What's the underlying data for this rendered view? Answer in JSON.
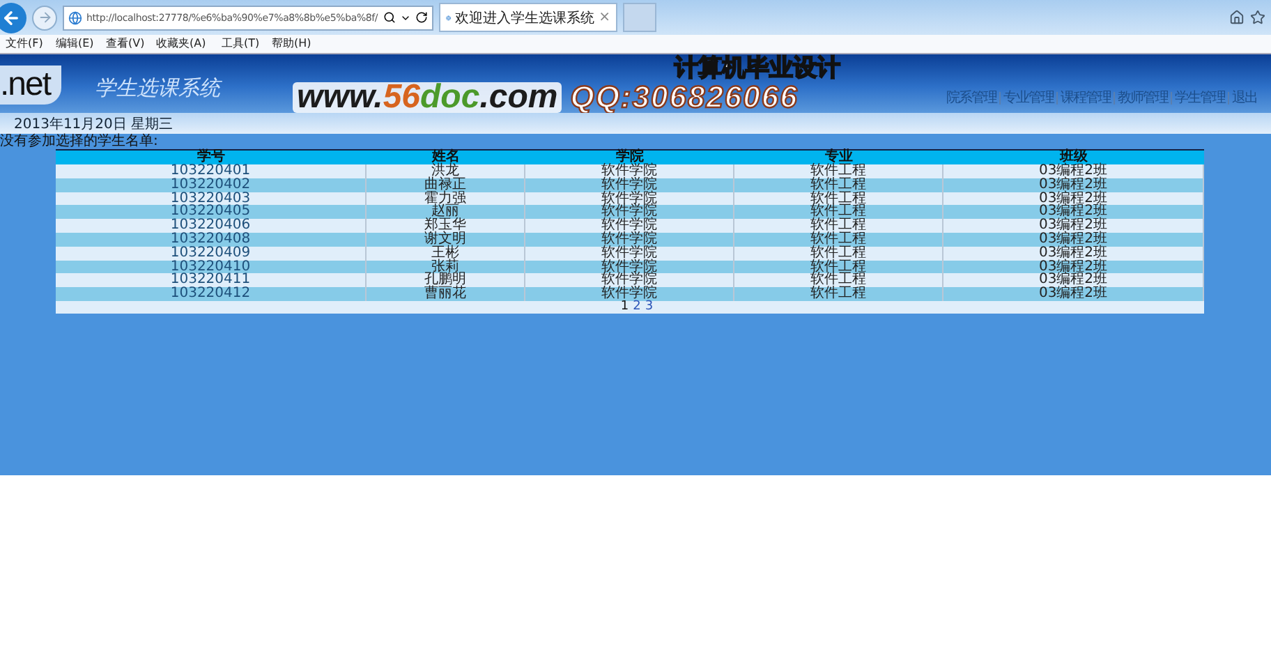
{
  "browser": {
    "address": "http://localhost:27778/%e6%ba%90%e7%a8%8b%e5%ba%8f/",
    "tab": {
      "title": "欢迎进入学生选课系统",
      "close": "×",
      "selected": true
    }
  },
  "menu_bar": [
    "文件(F)",
    "编辑(E)",
    "查看(V)",
    "收藏夹(A)",
    "工具(T)",
    "帮助(H)"
  ],
  "header": {
    "logo": ".net",
    "system_name": "学生选课系统",
    "slogan": "计算机毕业设计",
    "site": [
      {
        "text": "www.",
        "color": "#1c1c1c"
      },
      {
        "text": "56",
        "color": "#d7641e"
      },
      {
        "text": "doc",
        "color": "#4c9a2a"
      },
      {
        "text": ".com",
        "color": "#1c1c1c"
      }
    ],
    "qq": "QQ:306826066",
    "nav": [
      "院系管理",
      "专业管理",
      "课程管理",
      "教师管理",
      "学生管理",
      "退出"
    ]
  },
  "date": "2013年11月20日 星期三",
  "caption": "没有参加选择的学生名单:",
  "table": {
    "columns": [
      "学号",
      "姓名",
      "学院",
      "专业",
      "班级"
    ],
    "rows": [
      [
        "103220401",
        "洪龙",
        "软件学院",
        "软件工程",
        "03编程2班"
      ],
      [
        "103220402",
        "曲禄正",
        "软件学院",
        "软件工程",
        "03编程2班"
      ],
      [
        "103220403",
        "霍力强",
        "软件学院",
        "软件工程",
        "03编程2班"
      ],
      [
        "103220405",
        "赵丽",
        "软件学院",
        "软件工程",
        "03编程2班"
      ],
      [
        "103220406",
        "郑玉华",
        "软件学院",
        "软件工程",
        "03编程2班"
      ],
      [
        "103220408",
        "谢文明",
        "软件学院",
        "软件工程",
        "03编程2班"
      ],
      [
        "103220409",
        "王彬",
        "软件学院",
        "软件工程",
        "03编程2班"
      ],
      [
        "103220410",
        "张莉",
        "软件学院",
        "软件工程",
        "03编程2班"
      ],
      [
        "103220411",
        "孔鹏明",
        "软件学院",
        "软件工程",
        "03编程2班"
      ],
      [
        "103220412",
        "曹丽花",
        "软件学院",
        "软件工程",
        "03编程2班"
      ]
    ],
    "pages": [
      {
        "label": "1",
        "selected": true
      },
      {
        "label": "2",
        "selected": false
      },
      {
        "label": "3",
        "selected": false
      }
    ]
  }
}
